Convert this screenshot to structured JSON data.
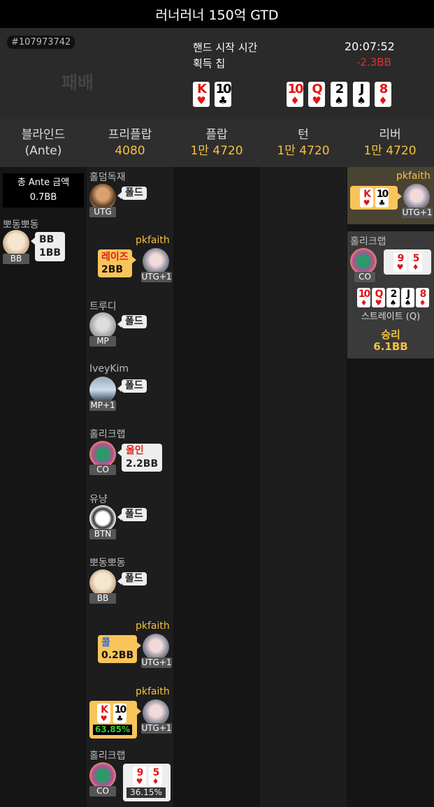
{
  "title": "러너러너 150억 GTD",
  "hand_id": "#107973742",
  "result_label": "패배",
  "start_time_label": "핸드 시작 시간",
  "start_time": "20:07:52",
  "chips_label": "획득 칩",
  "chips_value": "-2.3BB",
  "hole_cards": [
    {
      "rank": "K",
      "suit": "♥"
    },
    {
      "rank": "10",
      "suit": "♣"
    }
  ],
  "board_cards": [
    {
      "rank": "10",
      "suit": "♦"
    },
    {
      "rank": "Q",
      "suit": "♥"
    },
    {
      "rank": "2",
      "suit": "♠"
    },
    {
      "rank": "J",
      "suit": "♠"
    },
    {
      "rank": "8",
      "suit": "♦"
    }
  ],
  "streets": [
    {
      "name": "블라인드",
      "value": "(Ante)"
    },
    {
      "name": "프리플랍",
      "value": "4080"
    },
    {
      "name": "플랍",
      "value": "1만 4720"
    },
    {
      "name": "턴",
      "value": "1만 4720"
    },
    {
      "name": "리버",
      "value": "1만 4720"
    }
  ],
  "ante_box": {
    "label": "총 Ante 금액",
    "value": "0.7BB"
  },
  "bb_player": {
    "name": "뽀동뽀동",
    "pos": "BB",
    "action": "BB",
    "amount": "1BB"
  },
  "preflop": {
    "p1": {
      "name": "홀덤독재",
      "pos": "UTG",
      "action": "폴드"
    },
    "p2": {
      "name": "pkfaith",
      "pos": "UTG+1",
      "action": "레이즈",
      "amount": "2BB"
    },
    "p3": {
      "name": "트루디",
      "pos": "MP",
      "action": "폴드"
    },
    "p4": {
      "name": "IveyKim",
      "pos": "MP+1",
      "action": "폴드"
    },
    "p5": {
      "name": "홀리크랩",
      "pos": "CO",
      "action": "올인",
      "amount": "2.2BB"
    },
    "p6": {
      "name": "유냥",
      "pos": "BTN",
      "action": "폴드"
    },
    "p7": {
      "name": "뽀동뽀동",
      "pos": "BB",
      "action": "폴드"
    },
    "p8": {
      "name": "pkfaith",
      "pos": "UTG+1",
      "action": "콜",
      "amount": "0.2BB"
    },
    "p9": {
      "name": "pkfaith",
      "pos": "UTG+1",
      "equity": "63.85%"
    },
    "p10": {
      "name": "홀리크랩",
      "pos": "CO",
      "equity": "36.15%"
    }
  },
  "river": {
    "hero_name": "pkfaith",
    "hero_pos": "UTG+1",
    "winner_name": "홀리크랩",
    "winner_pos": "CO",
    "winner_cards": [
      {
        "rank": "9",
        "suit": "♥"
      },
      {
        "rank": "5",
        "suit": "♦"
      }
    ],
    "best_hand": [
      {
        "rank": "10",
        "suit": "♦"
      },
      {
        "rank": "Q",
        "suit": "♥"
      },
      {
        "rank": "2",
        "suit": "♠"
      },
      {
        "rank": "J",
        "suit": "♠"
      },
      {
        "rank": "8",
        "suit": "♦"
      }
    ],
    "hand_name": "스트레이트 (Q)",
    "win_label": "승리",
    "win_amount": "6.1BB"
  },
  "colors": {
    "accent": "#f5c23c",
    "loss": "#e03030",
    "win_bg": "#3a3a3a",
    "hero_bg": "#4a4332"
  }
}
